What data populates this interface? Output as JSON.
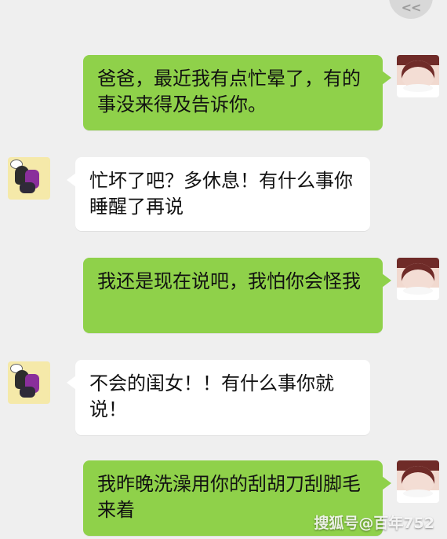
{
  "top_control": {
    "label": "<<"
  },
  "messages": [
    {
      "side": "right",
      "text": "爸爸，最近我有点忙晕了，有的事没来得及告诉你。"
    },
    {
      "side": "left",
      "text": "忙坏了吧？多休息！有什么事你睡醒了再说"
    },
    {
      "side": "right",
      "text": "我还是现在说吧，我怕你会怪我"
    },
    {
      "side": "left",
      "text": "不会的闺女！！有什么事你就说！"
    },
    {
      "side": "right",
      "text": "我昨晚洗澡用你的刮胡刀刮脚毛来着"
    }
  ],
  "watermark": "搜狐号@百年752",
  "colors": {
    "background": "#efefef",
    "right_bubble": "#8fd14a",
    "left_bubble": "#ffffff"
  }
}
